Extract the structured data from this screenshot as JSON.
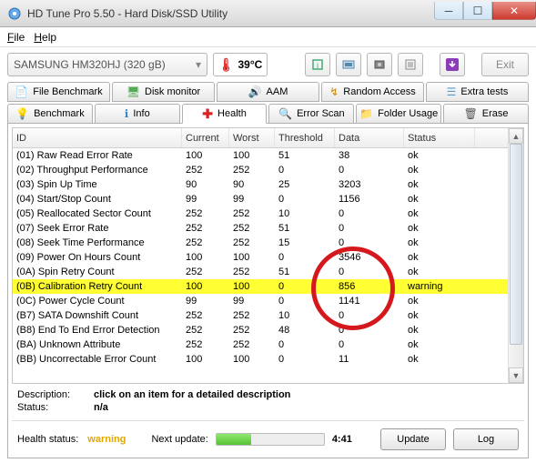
{
  "window": {
    "title": "HD Tune Pro 5.50 - Hard Disk/SSD Utility"
  },
  "menu": {
    "file": "File",
    "help": "Help"
  },
  "drive": {
    "name": "SAMSUNG HM320HJ (320 gB)"
  },
  "temp": {
    "value": "39°C"
  },
  "exit": {
    "label": "Exit"
  },
  "tabs1": {
    "fb": "File Benchmark",
    "dm": "Disk monitor",
    "aam": "AAM",
    "ra": "Random Access",
    "et": "Extra tests"
  },
  "tabs2": {
    "bm": "Benchmark",
    "info": "Info",
    "health": "Health",
    "es": "Error Scan",
    "fu": "Folder Usage",
    "erase": "Erase"
  },
  "cols": {
    "id": "ID",
    "cur": "Current",
    "wor": "Worst",
    "thr": "Threshold",
    "dat": "Data",
    "sta": "Status"
  },
  "rows": [
    {
      "id": "(01) Raw Read Error Rate",
      "cur": "100",
      "wor": "100",
      "thr": "51",
      "dat": "38",
      "sta": "ok",
      "hl": false
    },
    {
      "id": "(02) Throughput Performance",
      "cur": "252",
      "wor": "252",
      "thr": "0",
      "dat": "0",
      "sta": "ok",
      "hl": false
    },
    {
      "id": "(03) Spin Up Time",
      "cur": "90",
      "wor": "90",
      "thr": "25",
      "dat": "3203",
      "sta": "ok",
      "hl": false
    },
    {
      "id": "(04) Start/Stop Count",
      "cur": "99",
      "wor": "99",
      "thr": "0",
      "dat": "1156",
      "sta": "ok",
      "hl": false
    },
    {
      "id": "(05) Reallocated Sector Count",
      "cur": "252",
      "wor": "252",
      "thr": "10",
      "dat": "0",
      "sta": "ok",
      "hl": false
    },
    {
      "id": "(07) Seek Error Rate",
      "cur": "252",
      "wor": "252",
      "thr": "51",
      "dat": "0",
      "sta": "ok",
      "hl": false
    },
    {
      "id": "(08) Seek Time Performance",
      "cur": "252",
      "wor": "252",
      "thr": "15",
      "dat": "0",
      "sta": "ok",
      "hl": false
    },
    {
      "id": "(09) Power On Hours Count",
      "cur": "100",
      "wor": "100",
      "thr": "0",
      "dat": "3546",
      "sta": "ok",
      "hl": false
    },
    {
      "id": "(0A) Spin Retry Count",
      "cur": "252",
      "wor": "252",
      "thr": "51",
      "dat": "0",
      "sta": "ok",
      "hl": false
    },
    {
      "id": "(0B) Calibration Retry Count",
      "cur": "100",
      "wor": "100",
      "thr": "0",
      "dat": "856",
      "sta": "warning",
      "hl": true
    },
    {
      "id": "(0C) Power Cycle Count",
      "cur": "99",
      "wor": "99",
      "thr": "0",
      "dat": "1141",
      "sta": "ok",
      "hl": false
    },
    {
      "id": "(B7) SATA Downshift Count",
      "cur": "252",
      "wor": "252",
      "thr": "10",
      "dat": "0",
      "sta": "ok",
      "hl": false
    },
    {
      "id": "(B8) End To End Error Detection",
      "cur": "252",
      "wor": "252",
      "thr": "48",
      "dat": "0",
      "sta": "ok",
      "hl": false
    },
    {
      "id": "(BA) Unknown Attribute",
      "cur": "252",
      "wor": "252",
      "thr": "0",
      "dat": "0",
      "sta": "ok",
      "hl": false
    },
    {
      "id": "(BB) Uncorrectable Error Count",
      "cur": "100",
      "wor": "100",
      "thr": "0",
      "dat": "11",
      "sta": "ok",
      "hl": false
    }
  ],
  "desc": {
    "label": "Description:",
    "value": "click on an item for a detailed description"
  },
  "status": {
    "label": "Status:",
    "value": "n/a"
  },
  "bottom": {
    "hlabel": "Health status:",
    "hvalue": "warning",
    "nextlabel": "Next update:",
    "time": "4:41",
    "update": "Update",
    "log": "Log"
  }
}
